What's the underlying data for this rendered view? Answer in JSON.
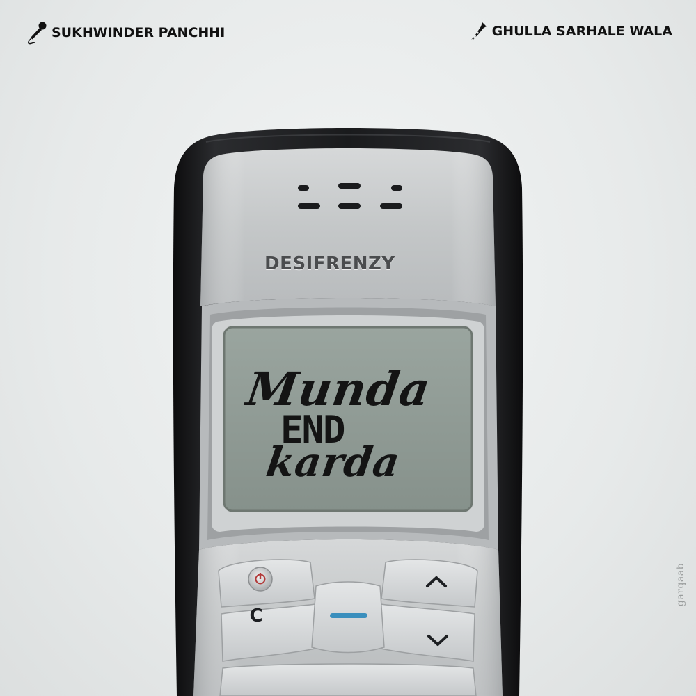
{
  "credits": {
    "singer": "SUKHWINDER PANCHHI",
    "singer_icon": "microphone-icon",
    "lyricist": "GHULLA SARHALE WALA",
    "lyricist_icon": "pen-nib-icon"
  },
  "phone": {
    "brand": "DESIFRENZY",
    "screen": {
      "line1": "Munda",
      "line2": "END",
      "line3": "karda"
    },
    "keys": {
      "power_icon": "power-icon",
      "clear_label": "C",
      "menu_icon": "menu-dash-icon",
      "up_icon": "chevron-up-icon",
      "down_icon": "chevron-down-icon"
    }
  },
  "watermark": "garqaab",
  "colors": {
    "background": "#e9ecec",
    "phone_body": "#1c1d1f",
    "faceplate": "#c9cccd",
    "screen": "#8e9a94",
    "text": "#111111"
  }
}
